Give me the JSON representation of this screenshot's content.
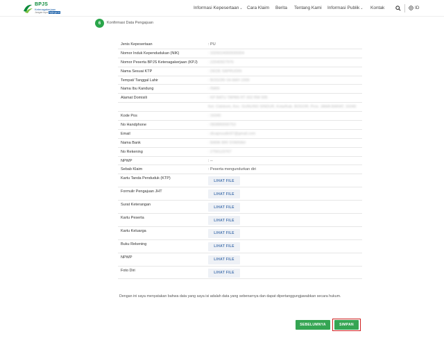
{
  "header": {
    "logo": {
      "brand": "BPJS",
      "sub": "Ketenagakerjaan",
      "tagline_prefix": "Jangan lupa",
      "tagline_badge": "bpjs.go.id"
    },
    "nav": [
      {
        "label": "Informasi Kepesertaan",
        "dropdown": true
      },
      {
        "label": "Cara Klaim",
        "dropdown": false
      },
      {
        "label": "Berita",
        "dropdown": false
      },
      {
        "label": "Tentang Kami",
        "dropdown": false
      },
      {
        "label": "Informasi Publik",
        "dropdown": true
      },
      {
        "label": "Kontak",
        "dropdown": false
      }
    ],
    "caret": "⌄",
    "lang": "ID",
    "icons": [
      "search-icon",
      "globe-icon"
    ]
  },
  "step": {
    "number": "6",
    "title": "Konfirmasi Data Pengajuan"
  },
  "rows": [
    {
      "label": "Jenis Kepesertaan",
      "value": ": PU",
      "blur": false
    },
    {
      "label": "Nomor Induk Kependudukan (NIK)",
      "value": ": 3326024000000004",
      "blur": true
    },
    {
      "label": "Nomor Peserta BPJS Ketenagakerjaan (KPJ)",
      "value": ": 22040927976",
      "blur": true
    },
    {
      "label": "Nama Sesuai KTP",
      "value": ": DEDE SAPRUDIN",
      "blur": true
    },
    {
      "label": "Tempat/ Tanggal Lahir",
      "value": ": BOGOR/ 04-MAY-1999",
      "blur": true
    },
    {
      "label": "Nama Ibu Kandung",
      "value": ": INAN",
      "blur": true
    },
    {
      "label": "Alamat Domisili",
      "value": ": KP BATU TAPAN RT 002 RW 005",
      "blur": true
    },
    {
      "label": "",
      "value": "Kel. Cidokom, Kec. GUNUNG SINDUR, Kota/Kab. BOGOR, Prov. JAWA BARAT, 16340",
      "blur": true
    },
    {
      "label": "Kode Pos",
      "value": ": 16340",
      "blur": true
    },
    {
      "label": "No Handphone",
      "value": ": 083880000753",
      "blur": true
    },
    {
      "label": "Email",
      "value": ": dicapruudin97@gmail.com",
      "blur": true
    },
    {
      "label": "Nama Bank",
      "value": ": BANK BRI SYARIAH",
      "blur": true
    },
    {
      "label": "No Rekening",
      "value": ": 2756123707",
      "blur": true
    },
    {
      "label": "NPWP",
      "value": ": --",
      "blur": false
    },
    {
      "label": "Sebab Klaim",
      "value": ": Peserta mengundurkan diri",
      "blur": false
    }
  ],
  "file_rows": [
    {
      "label": "Kartu Tanda Penduduk (KTP)"
    },
    {
      "label": "Formulir Pengajuan JHT"
    },
    {
      "label": "Surat Keterangan"
    },
    {
      "label": "Kartu Peserta"
    },
    {
      "label": "Kartu Keluarga"
    },
    {
      "label": "Buku Rekening"
    },
    {
      "label": "NPWP"
    },
    {
      "label": "Foto Diri"
    }
  ],
  "file_button_label": "LIHAT FILE",
  "declaration": "Dengan ini saya menyatakan bahwa data yang saya isi adalah data yang sebenarnya dan dapat dipertanggungjawabkan secara hukum.",
  "buttons": {
    "prev": "SEBELUMNYA",
    "save": "SIMPAN"
  },
  "colors": {
    "accent": "#35a553",
    "highlight": "#d02020",
    "file_button_text": "#4a76b0"
  }
}
